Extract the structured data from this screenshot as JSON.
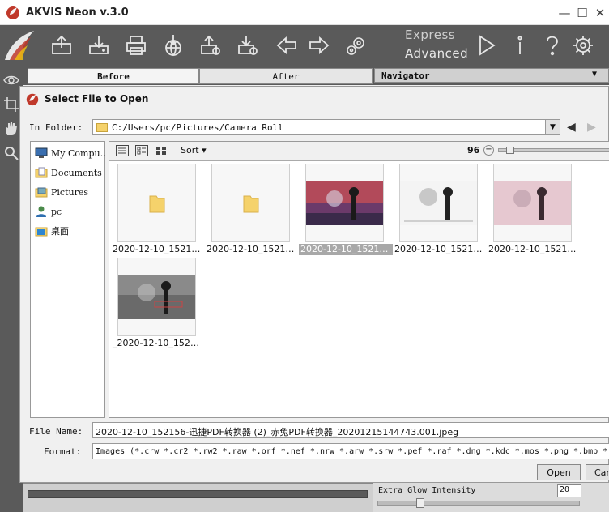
{
  "window": {
    "title": "AKVIS Neon v.3.0",
    "controls": {
      "minimize": "—",
      "maximize": "☐",
      "close": "✕"
    }
  },
  "toolbar": {
    "icons": [
      "open-icon",
      "save-icon",
      "print-icon",
      "share-icon",
      "import-preset-icon",
      "export-preset-icon",
      "undo-arrow-icon",
      "redo-arrow-icon",
      "batch-settings-icon",
      "run-icon",
      "info-icon",
      "help-icon",
      "preferences-icon"
    ],
    "mode_express": "Express",
    "mode_advanced": "Advanced"
  },
  "tabs": {
    "before": "Before",
    "after": "After",
    "navigator": "Navigator"
  },
  "dialog": {
    "title": "Select File to Open",
    "in_folder_label": "In Folder:",
    "path": "C:/Users/pc/Pictures/Camera Roll",
    "tree": [
      {
        "label": "My Compu…",
        "icon": "computer-icon"
      },
      {
        "label": "Documents",
        "icon": "documents-folder-icon"
      },
      {
        "label": "Pictures",
        "icon": "pictures-folder-icon"
      },
      {
        "label": "pc",
        "icon": "user-icon"
      },
      {
        "label": "桌面",
        "icon": "desktop-folder-icon"
      }
    ],
    "sort_label": "Sort",
    "zoom_value": "96",
    "files": [
      {
        "caption": "2020-12-10_15215…",
        "kind": "folder"
      },
      {
        "caption": "2020-12-10_15215…",
        "kind": "folder"
      },
      {
        "caption": "2020-12-10_15215…",
        "kind": "image-color"
      },
      {
        "caption": "2020-12-10_15215…",
        "kind": "image-bw"
      },
      {
        "caption": "2020-12-10_15215…",
        "kind": "image-pink"
      },
      {
        "caption": "_2020-12-10_1521…",
        "kind": "image-gray"
      }
    ],
    "selected_index": 2,
    "file_name_label": "File Name:",
    "file_name_value": "2020-12-10_152156-迅捷PDF转换器 (2)_赤兔PDF转换器_20201215144743.001.jpeg",
    "format_label": "Format:",
    "format_value": "Images (*.crw *.cr2 *.rw2 *.raw *.orf *.nef *.nrw *.arw *.srw *.pef *.raf *.dng *.kdc *.mos *.png *.bmp *.",
    "open_button": "Open",
    "cancel_button": "Cancel"
  },
  "params": {
    "glow_label": "Extra Glow Intensity",
    "glow_value": "20"
  },
  "colors": {
    "toolbar_bg": "#5a5a5a",
    "folder": "#f5d26b",
    "selection": "#a8a8a8"
  }
}
